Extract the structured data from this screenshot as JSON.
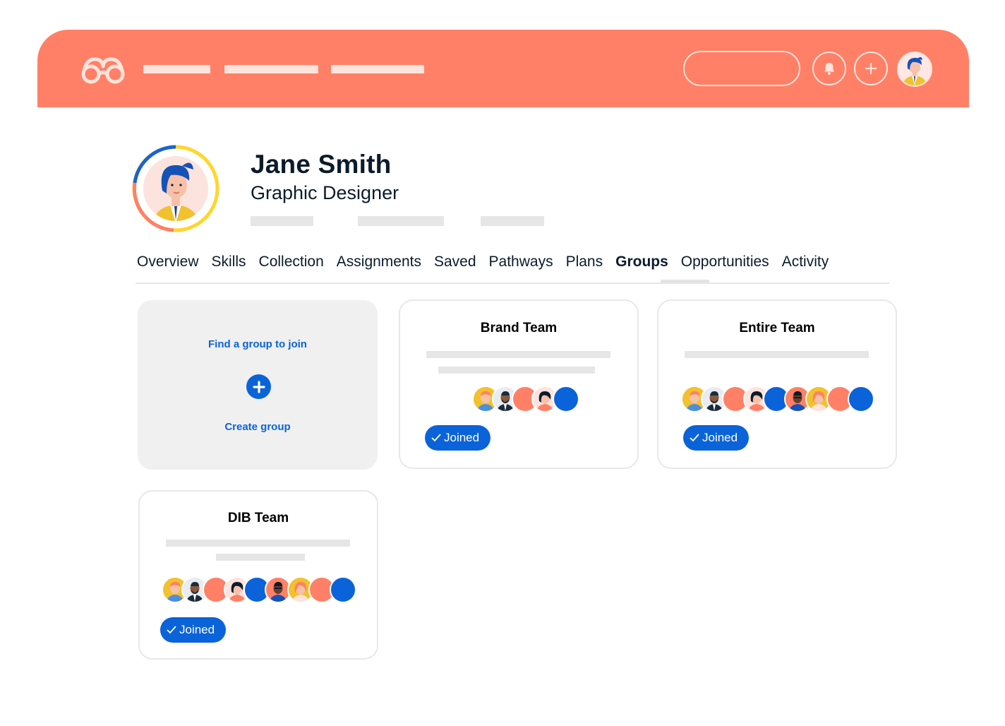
{
  "colors": {
    "header": "#ff8066",
    "header_line": "#ffe3dc",
    "accent_blue": "#0a63d9",
    "placeholder_gray": "#e6e6e6",
    "create_card_bg": "#f0f0f0"
  },
  "header": {
    "logo_icon": "glasses-logo-icon",
    "notification_icon": "bell-icon",
    "add_icon": "plus-icon"
  },
  "profile": {
    "name": "Jane Smith",
    "title": "Graphic Designer"
  },
  "tabs": [
    {
      "label": "Overview",
      "active": false
    },
    {
      "label": "Skills",
      "active": false
    },
    {
      "label": "Collection",
      "active": false
    },
    {
      "label": "Assignments",
      "active": false
    },
    {
      "label": "Saved",
      "active": false
    },
    {
      "label": "Pathways",
      "active": false
    },
    {
      "label": "Plans",
      "active": false
    },
    {
      "label": "Groups",
      "active": true
    },
    {
      "label": "Opportunities",
      "active": false
    },
    {
      "label": "Activity",
      "active": false
    }
  ],
  "create_card": {
    "find_label": "Find a group to join",
    "create_label": "Create group"
  },
  "groups": [
    {
      "title": "Brand Team",
      "status": "Joined",
      "member_count": 5
    },
    {
      "title": "Entire Team",
      "status": "Joined",
      "member_count": 9
    },
    {
      "title": "DIB Team",
      "status": "Joined",
      "member_count": 9
    }
  ]
}
